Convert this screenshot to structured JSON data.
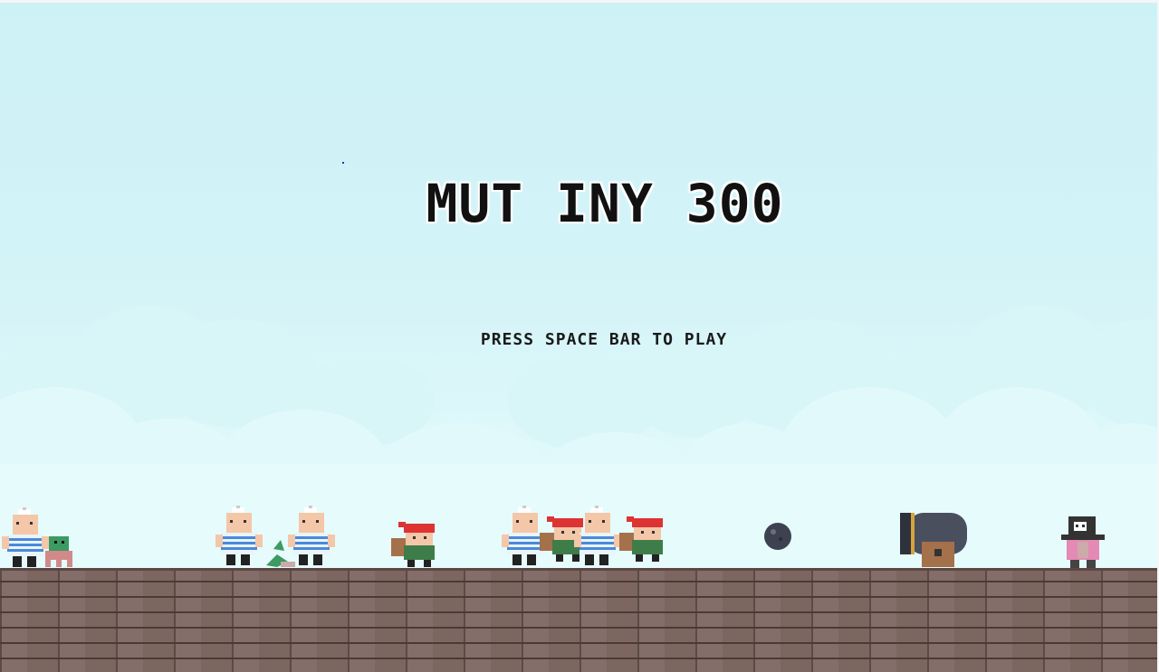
{
  "game": {
    "title": "MUT INY 300",
    "prompt": "PRESS SPACE BAR TO PLAY"
  },
  "characters": [
    {
      "type": "sailor"
    },
    {
      "type": "sailor"
    },
    {
      "type": "sailor"
    },
    {
      "type": "sailor"
    },
    {
      "type": "sailor"
    },
    {
      "type": "red-bandana-pirate"
    },
    {
      "type": "red-bandana-pirate"
    },
    {
      "type": "red-bandana-pirate"
    },
    {
      "type": "green-octopus"
    },
    {
      "type": "mermaid-tail"
    },
    {
      "type": "cannonball"
    },
    {
      "type": "cannon"
    },
    {
      "type": "skull-captain"
    }
  ],
  "colors": {
    "sky_top": "#cdf2f6",
    "sky_bottom": "#e6fbfc",
    "floor": "#7d6560",
    "title": "#111111"
  }
}
